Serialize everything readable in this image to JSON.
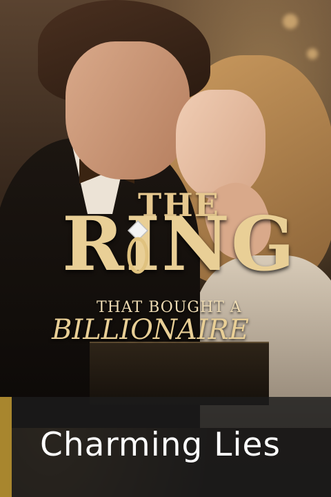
{
  "cover": {
    "title_line1": "THE",
    "title_line2": "RING",
    "title_line3": "THAT BOUGHT A",
    "title_line4": "BILLIONAIRE"
  },
  "caption": {
    "text": "Charming Lies",
    "accent_color": "#a8862e"
  },
  "icons": {
    "ring": "diamond-ring-icon"
  }
}
